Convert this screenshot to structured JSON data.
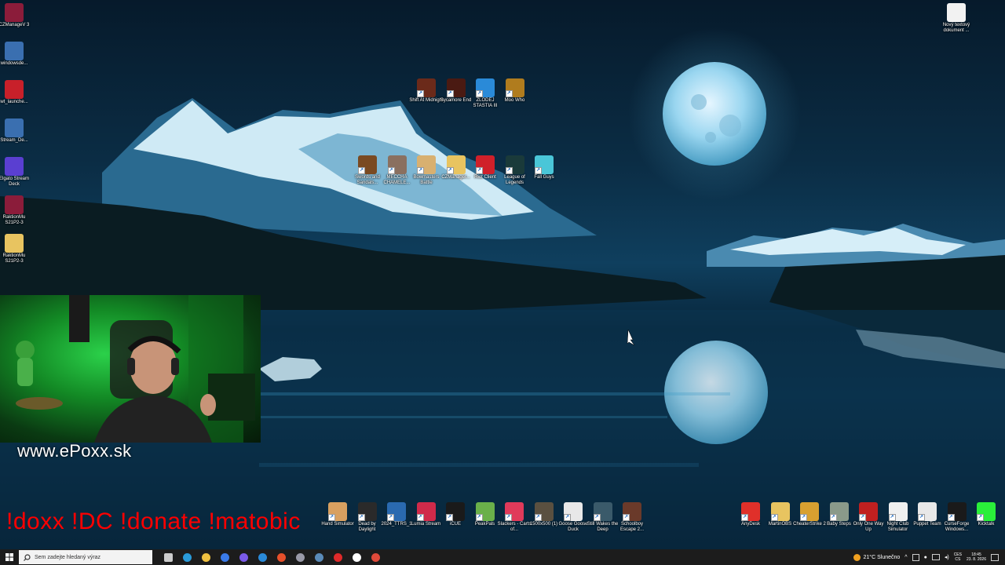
{
  "desktop": {
    "left_icons": [
      {
        "label": "CZManageV 3",
        "icon": "winrar-icon",
        "color": "#8b1c3a"
      },
      {
        "label": "windowsde...",
        "icon": "setup-icon",
        "color": "#3a6fb0"
      },
      {
        "label": "wt_launche...",
        "icon": "warthunder-icon",
        "color": "#c8202a"
      },
      {
        "label": "Stream_De...",
        "icon": "setup-icon",
        "color": "#3a6fb0"
      },
      {
        "label": "Elgato Stream Deck",
        "icon": "streamdeck-icon",
        "color": "#5a3fd1"
      },
      {
        "label": "RaktionMu S21P2-3",
        "icon": "winrar-icon",
        "color": "#8b1c3a"
      },
      {
        "label": "RaktionMu S21P2-3",
        "icon": "folder-icon",
        "color": "#e8c460"
      }
    ],
    "top_right_icon": {
      "label": "Nový textový dokument ...",
      "icon": "text-file-icon",
      "color": "#f2f2f2"
    },
    "center_row1": [
      {
        "label": "Shift At Midnight",
        "icon": "game-icon",
        "color": "#6b2a1a"
      },
      {
        "label": "Sycamore End",
        "icon": "game-icon",
        "color": "#4a1a12"
      },
      {
        "label": "ZLODEJ STASTIA III",
        "icon": "globe-icon",
        "color": "#2a8ad8"
      },
      {
        "label": "Moo Who",
        "icon": "game-icon",
        "color": "#b07c1e"
      }
    ],
    "center_row2": [
      {
        "label": "Swords and Sandals...",
        "icon": "game-icon",
        "color": "#7a4a22"
      },
      {
        "label": "MECCHA CHAMELE...",
        "icon": "game-icon",
        "color": "#8a7060"
      },
      {
        "label": "Bowmasters Battle",
        "icon": "game-icon",
        "color": "#d8b070"
      },
      {
        "label": "CZManager...",
        "icon": "folder-icon",
        "color": "#e8c460"
      },
      {
        "label": "Riot Client",
        "icon": "riot-icon",
        "color": "#d0202a"
      },
      {
        "label": "League of Legends",
        "icon": "lol-icon",
        "color": "#1a3a3a"
      },
      {
        "label": "Fall Guys",
        "icon": "fallguys-icon",
        "color": "#4ac6d8"
      }
    ],
    "bottom_center": [
      {
        "label": "Hand Simulator",
        "icon": "game-icon",
        "color": "#d8a060"
      },
      {
        "label": "Dead by Daylight",
        "icon": "game-icon",
        "color": "#2a2a2a"
      },
      {
        "label": "2024_TTRS_1",
        "icon": "image-icon",
        "color": "#2a6ab0"
      },
      {
        "label": "Lumia Stream",
        "icon": "lumia-icon",
        "color": "#d02a4a"
      },
      {
        "label": "iCUE",
        "icon": "icue-icon",
        "color": "#1a1a1a"
      },
      {
        "label": "PeakPals",
        "icon": "game-icon",
        "color": "#6ab04a"
      },
      {
        "label": "Slackers - Carts of...",
        "icon": "game-icon",
        "color": "#e03a5a"
      },
      {
        "label": "1500x500 (1)",
        "icon": "image-icon",
        "color": "#5a5040"
      },
      {
        "label": "Goose Goose Duck",
        "icon": "game-icon",
        "color": "#e8e8e8"
      },
      {
        "label": "Still Wakes the Deep",
        "icon": "game-icon",
        "color": "#3a5a6a"
      },
      {
        "label": "Schoolboy Escape 2...",
        "icon": "game-icon",
        "color": "#6a3a2a"
      }
    ],
    "bottom_right": [
      {
        "label": "AnyDesk",
        "icon": "anydesk-icon",
        "color": "#e0302a"
      },
      {
        "label": "MartinOBS",
        "icon": "folder-icon",
        "color": "#e8c460"
      },
      {
        "label": "CheaterStrike 2",
        "icon": "game-icon",
        "color": "#d8a030"
      },
      {
        "label": "Baby Steps",
        "icon": "game-icon",
        "color": "#8a9a8a"
      },
      {
        "label": "Only One Way Up",
        "icon": "game-icon",
        "color": "#c02020"
      },
      {
        "label": "Night Club Simulator",
        "icon": "game-icon",
        "color": "#f0f0f0"
      },
      {
        "label": "Puppet Team",
        "icon": "game-icon",
        "color": "#e8e8e8"
      },
      {
        "label": "CurseForge Windows...",
        "icon": "curseforge-icon",
        "color": "#1a1a1a"
      },
      {
        "label": "Kicktalk",
        "icon": "kick-icon",
        "color": "#2aef3a"
      }
    ]
  },
  "overlay": {
    "website": "www.ePoxx.sk",
    "commands": "!doxx  !DC !donate !matobic"
  },
  "taskbar": {
    "search_placeholder": "Sem zadejte hledaný výraz",
    "pinned": [
      {
        "name": "task-view-icon",
        "color": "#cccccc"
      },
      {
        "name": "edge-icon",
        "color": "#2a9ad8"
      },
      {
        "name": "file-explorer-icon",
        "color": "#f0c040"
      },
      {
        "name": "store-icon",
        "color": "#3a7ae8"
      },
      {
        "name": "copilot-icon",
        "color": "#7a5ae8"
      },
      {
        "name": "mail-icon",
        "color": "#2a8ad8"
      },
      {
        "name": "brave-icon",
        "color": "#e8502a"
      },
      {
        "name": "obs-icon",
        "color": "#9a9aa8"
      },
      {
        "name": "steam-icon",
        "color": "#5a8ab8"
      },
      {
        "name": "riot-icon",
        "color": "#e02a2a"
      },
      {
        "name": "app-icon",
        "color": "#ffffff"
      },
      {
        "name": "chrome-icon",
        "color": "#e04a3a"
      }
    ],
    "weather": {
      "temp": "21°C",
      "condition": "Slunečno"
    },
    "language": {
      "top": "CES",
      "bottom": "CS"
    },
    "clock": {
      "time": "18:45",
      "date": "23. 8. 2026"
    }
  }
}
